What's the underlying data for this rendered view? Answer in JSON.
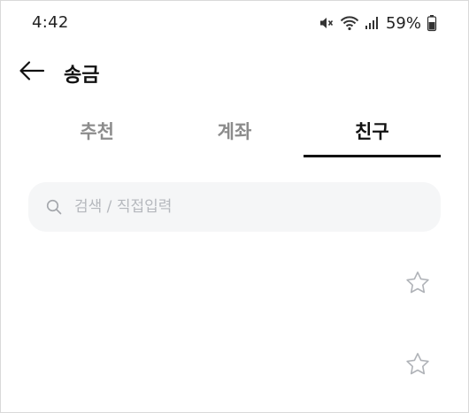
{
  "status_bar": {
    "time": "4:42",
    "battery_percent": "59%",
    "icons": [
      "mute-icon",
      "wifi-icon",
      "signal-icon",
      "battery-icon"
    ]
  },
  "app_bar": {
    "title": "송금",
    "back_icon": "arrow-left-icon"
  },
  "tabs": [
    {
      "label": "추천",
      "active": false
    },
    {
      "label": "계좌",
      "active": false
    },
    {
      "label": "친구",
      "active": true
    }
  ],
  "search": {
    "placeholder": "검색 / 직접입력",
    "value": ""
  },
  "friends": [
    {
      "name": "",
      "favorite": false
    },
    {
      "name": "",
      "favorite": false
    }
  ],
  "colors": {
    "text": "#111111",
    "inactive_tab": "#8c8c8c",
    "search_bg": "#f5f6f7",
    "placeholder": "#b5b8bd",
    "star_outline": "#b0b3b8"
  }
}
